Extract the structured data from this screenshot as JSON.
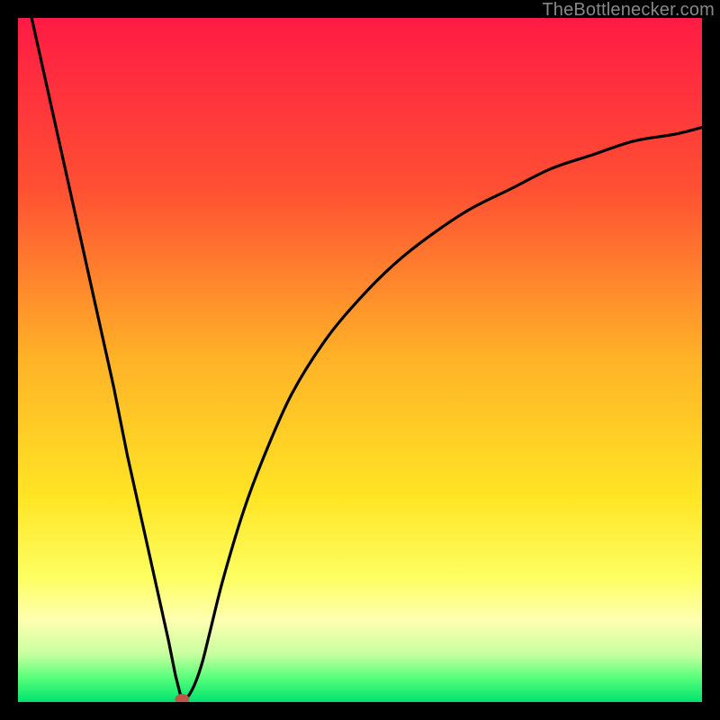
{
  "credit": "TheBottlenecker.com",
  "chart_data": {
    "type": "line",
    "title": "",
    "xlabel": "",
    "ylabel": "",
    "xlim": [
      0,
      100
    ],
    "ylim": [
      0,
      100
    ],
    "marker": {
      "x": 24,
      "y": 0,
      "color": "#c0564a"
    },
    "gradient_stops": [
      {
        "offset": 0.0,
        "color": "#ff1b44"
      },
      {
        "offset": 0.25,
        "color": "#ff5033"
      },
      {
        "offset": 0.5,
        "color": "#ffb327"
      },
      {
        "offset": 0.7,
        "color": "#ffe524"
      },
      {
        "offset": 0.82,
        "color": "#fdff63"
      },
      {
        "offset": 0.88,
        "color": "#ffffb0"
      },
      {
        "offset": 0.93,
        "color": "#c8ff9e"
      },
      {
        "offset": 0.965,
        "color": "#55ff7a"
      },
      {
        "offset": 1.0,
        "color": "#00e36e"
      }
    ],
    "series": [
      {
        "name": "left-arm",
        "x": [
          2,
          4,
          6,
          8,
          10,
          12,
          14,
          16,
          18,
          20,
          22,
          23,
          24
        ],
        "values": [
          100,
          91,
          82,
          73,
          64,
          55,
          46,
          36,
          27,
          18,
          9,
          4,
          0
        ]
      },
      {
        "name": "right-arm",
        "x": [
          24,
          25,
          26,
          27,
          28,
          30,
          33,
          36,
          40,
          45,
          50,
          55,
          60,
          66,
          72,
          78,
          84,
          90,
          96,
          100
        ],
        "values": [
          0,
          1,
          3,
          6,
          10,
          18,
          28,
          36,
          45,
          53,
          59,
          64,
          68,
          72,
          75,
          78,
          80,
          82,
          83,
          84
        ]
      }
    ]
  }
}
